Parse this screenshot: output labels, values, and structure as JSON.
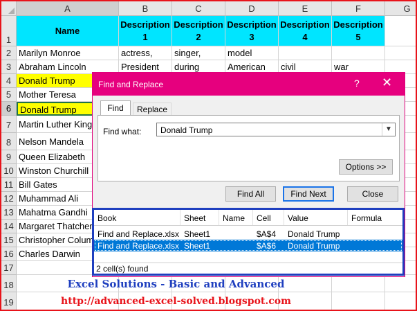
{
  "columns": [
    "A",
    "B",
    "C",
    "D",
    "E",
    "F",
    "G"
  ],
  "rows": [
    "1",
    "2",
    "3",
    "4",
    "5",
    "6",
    "7",
    "8",
    "9",
    "10",
    "11",
    "12",
    "13",
    "14",
    "15",
    "16",
    "17",
    "18",
    "19"
  ],
  "header_cells": {
    "a1": "Name",
    "b1": "Description 1",
    "c1": "Description 2",
    "d1": "Description 3",
    "e1": "Description 4",
    "f1": "Description 5"
  },
  "names": [
    "Marilyn Monroe",
    "Abraham Lincoln",
    "Donald Trump",
    "Mother Teresa",
    "Donald Trump",
    "Martin Luther King",
    "Nelson Mandela",
    "Queen Elizabeth",
    "Winston Churchill",
    "Bill Gates",
    "Muhammad Ali",
    "Mahatma Gandhi",
    "Margaret Thatcher",
    "Christopher Columbus",
    "Charles Darwin"
  ],
  "row2": {
    "b": "actress,",
    "c": "singer,",
    "d": "model"
  },
  "row3": {
    "b": "President",
    "c": "during",
    "d": "American",
    "e": "civil",
    "f": "war"
  },
  "footer": {
    "title": "Excel Solutions - Basic and Advanced",
    "url": "http://advanced-excel-solved.blogspot.com"
  },
  "dialog": {
    "title": "Find and Replace",
    "help": "?",
    "close": "✕",
    "tabs": {
      "find": "Find",
      "replace": "Replace"
    },
    "find_what_label": "Find what:",
    "find_what_value": "Donald Trump",
    "options_button": "Options >>",
    "find_all_button": "Find All",
    "find_next_button": "Find Next",
    "close_button": "Close",
    "results_headers": {
      "book": "Book",
      "sheet": "Sheet",
      "name": "Name",
      "cell": "Cell",
      "value": "Value",
      "formula": "Formula"
    },
    "results": [
      {
        "book": "Find and Replace.xlsx",
        "sheet": "Sheet1",
        "name": "",
        "cell": "$A$4",
        "value": "Donald Trump",
        "formula": ""
      },
      {
        "book": "Find and Replace.xlsx",
        "sheet": "Sheet1",
        "name": "",
        "cell": "$A$6",
        "value": "Donald Trump",
        "formula": ""
      }
    ],
    "status": "2 cell(s) found"
  },
  "colors": {
    "header_fill": "#00e5ff",
    "highlight": "#ffff00",
    "dialog_accent": "#e6007e",
    "results_border": "#1f3fbf",
    "frame_border": "#e8131a"
  }
}
